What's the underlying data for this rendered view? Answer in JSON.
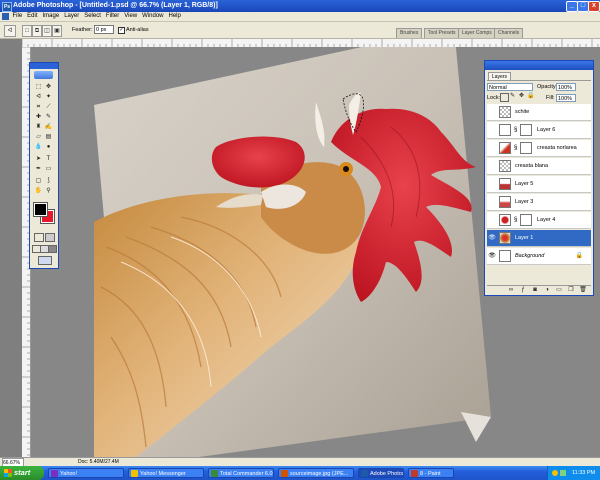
{
  "window": {
    "title": "Adobe Photoshop - [Untitled-1.psd @ 66.7% (Layer 1, RGB/8)]",
    "controls": [
      "_",
      "□",
      "x"
    ]
  },
  "menu": [
    "File",
    "Edit",
    "Image",
    "Layer",
    "Select",
    "Filter",
    "View",
    "Window",
    "Help"
  ],
  "options": {
    "feather_label": "Feather:",
    "feather_value": "0 px",
    "antialias_label": "Anti-alias",
    "antialias_checked": "✓",
    "palette_tabs": [
      "Brushes",
      "Tool Presets",
      "Layer Comps",
      "Channels"
    ]
  },
  "layers_panel": {
    "tab": "Layers",
    "blend_mode": "Normal",
    "opacity_label": "Opacity:",
    "opacity_value": "100%",
    "lock_label": "Lock:",
    "fill_label": "Fill:",
    "fill_value": "100%",
    "layers": [
      {
        "name": "schite",
        "visible": false,
        "active": false
      },
      {
        "name": "Layer 6",
        "visible": false,
        "active": false
      },
      {
        "name": "creasta norlarea",
        "visible": false,
        "active": false
      },
      {
        "name": "creasta blana",
        "visible": false,
        "active": false
      },
      {
        "name": "Layer 5",
        "visible": false,
        "active": false
      },
      {
        "name": "Layer 3",
        "visible": false,
        "active": false
      },
      {
        "name": "Layer 4",
        "visible": false,
        "active": false
      },
      {
        "name": "Layer 1",
        "visible": true,
        "active": true
      },
      {
        "name": "Background",
        "visible": true,
        "active": false
      }
    ]
  },
  "status": {
    "zoom": "66.67%",
    "doc": "Doc: 5.40M/27.4M"
  },
  "taskbar": {
    "start": "start",
    "tasks": [
      {
        "label": "Yahoo!",
        "color": "#7b2fbf"
      },
      {
        "label": "Yahoo! Messenger",
        "color": "#f2c200"
      },
      {
        "label": "Total Commander 6.0...",
        "color": "#3a8a3a"
      },
      {
        "label": "sourceimage.jpg (JPE...",
        "color": "#d35400"
      },
      {
        "label": "Adobe Photoshop - [...",
        "color": "#1d5aa8"
      },
      {
        "label": "8 - Paint",
        "color": "#c0392b"
      }
    ],
    "clock": "11:33 PM"
  },
  "colors": {
    "foreground": "#000000",
    "background": "#e8182a",
    "selection": "#316ac5"
  }
}
